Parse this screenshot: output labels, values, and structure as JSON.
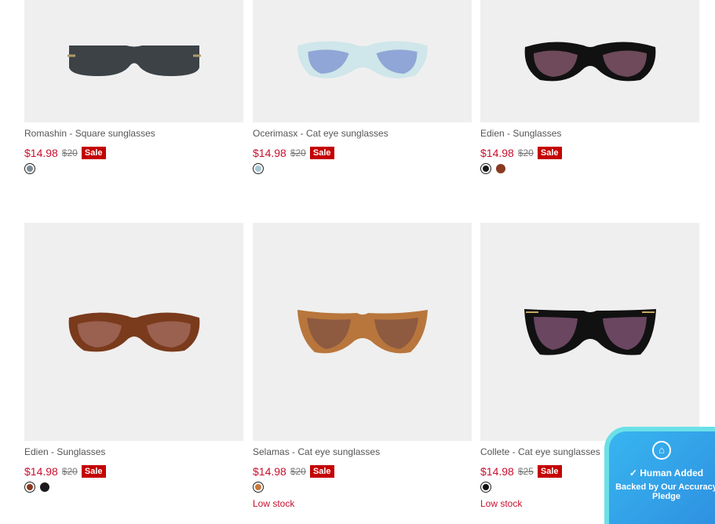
{
  "products": [
    {
      "name": "Romashin - Square sunglasses",
      "price": "$14.98",
      "old_price": "$20",
      "badge": "Sale",
      "swatches": [
        "#7a8a94"
      ],
      "stock": ""
    },
    {
      "name": "Ocerimasx - Cat eye sunglasses",
      "price": "$14.98",
      "old_price": "$20",
      "badge": "Sale",
      "swatches": [
        "#a6c8d4"
      ],
      "stock": ""
    },
    {
      "name": "Edien - Sunglasses",
      "price": "$14.98",
      "old_price": "$20",
      "badge": "Sale",
      "swatches": [
        "#1a1a1a",
        "#8a3a20"
      ],
      "stock": ""
    },
    {
      "name": "Edien - Sunglasses",
      "price": "$14.98",
      "old_price": "$20",
      "badge": "Sale",
      "swatches": [
        "#8a3a20",
        "#1a1a1a"
      ],
      "stock": ""
    },
    {
      "name": "Selamas - Cat eye sunglasses",
      "price": "$14.98",
      "old_price": "$20",
      "badge": "Sale",
      "swatches": [
        "#c8783a"
      ],
      "stock": "Low stock"
    },
    {
      "name": "Collete - Cat eye sunglasses",
      "price": "$14.98",
      "old_price": "$25",
      "badge": "Sale",
      "swatches": [
        "#111111"
      ],
      "stock": "Low stock"
    }
  ],
  "accuracy_badge": {
    "title": "Human Added",
    "subtitle": "Backed by Our Accuracy Pledge",
    "icon": "house-shield-icon",
    "check_icon": "check-circle-icon"
  }
}
